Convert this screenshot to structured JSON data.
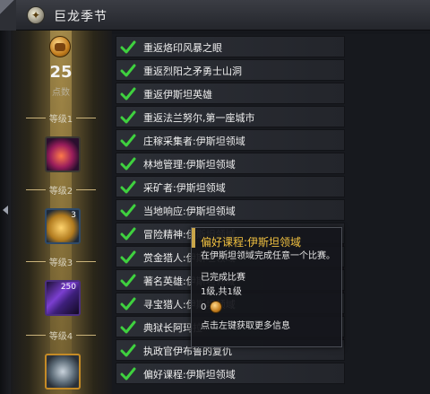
{
  "window": {
    "title": "巨龙季节",
    "logo_icon": "gw2-seasonal-emblem-icon"
  },
  "progress": {
    "points": "25",
    "points_label": "点数",
    "tiers": [
      {
        "label": "等级1",
        "reward_icon": "dragon-egg-orb-icon",
        "reward_count": ""
      },
      {
        "label": "等级2",
        "reward_icon": "gold-coin-icon",
        "reward_count": "3"
      },
      {
        "label": "等级3",
        "reward_icon": "purple-crystal-icon",
        "reward_count": "250"
      },
      {
        "label": "等级4",
        "reward_icon": "treasure-chest-icon",
        "reward_count": ""
      }
    ]
  },
  "achievements": [
    {
      "label": "重返烙印风暴之眼",
      "completed": true
    },
    {
      "label": "重返烈阳之矛勇士山洞",
      "completed": true
    },
    {
      "label": "重返伊斯坦英雄",
      "completed": true
    },
    {
      "label": "重返法兰努尔,第一座城市",
      "completed": true
    },
    {
      "label": "庄稼采集者:伊斯坦领域",
      "completed": true
    },
    {
      "label": "林地管理:伊斯坦领域",
      "completed": true
    },
    {
      "label": "采矿者:伊斯坦领域",
      "completed": true
    },
    {
      "label": "当地响应:伊斯坦领域",
      "completed": true
    },
    {
      "label": "冒险精神:伊斯坦领域",
      "completed": true
    },
    {
      "label": "赏金猎人:伊斯坦领域",
      "completed": true
    },
    {
      "label": "著名英雄:伊斯坦领域",
      "completed": true
    },
    {
      "label": "寻宝猎人:伊斯坦领域",
      "completed": true
    },
    {
      "label": "典狱长阿玛拉",
      "completed": true
    },
    {
      "label": "执政官伊布鲁的复仇",
      "completed": true
    },
    {
      "label": "偏好课程:伊斯坦领域",
      "completed": true
    }
  ],
  "tooltip": {
    "title": "偏好课程:伊斯坦领域",
    "description": "在伊斯坦领域完成任意一个比赛。",
    "status": "已完成比赛",
    "progress": "1级,共1级",
    "reward_points": "0",
    "hint": "点击左键获取更多信息"
  },
  "colors": {
    "accent_gold": "#f0c040",
    "check_green": "#3fd13f",
    "row_bg": "#2c2f36"
  }
}
